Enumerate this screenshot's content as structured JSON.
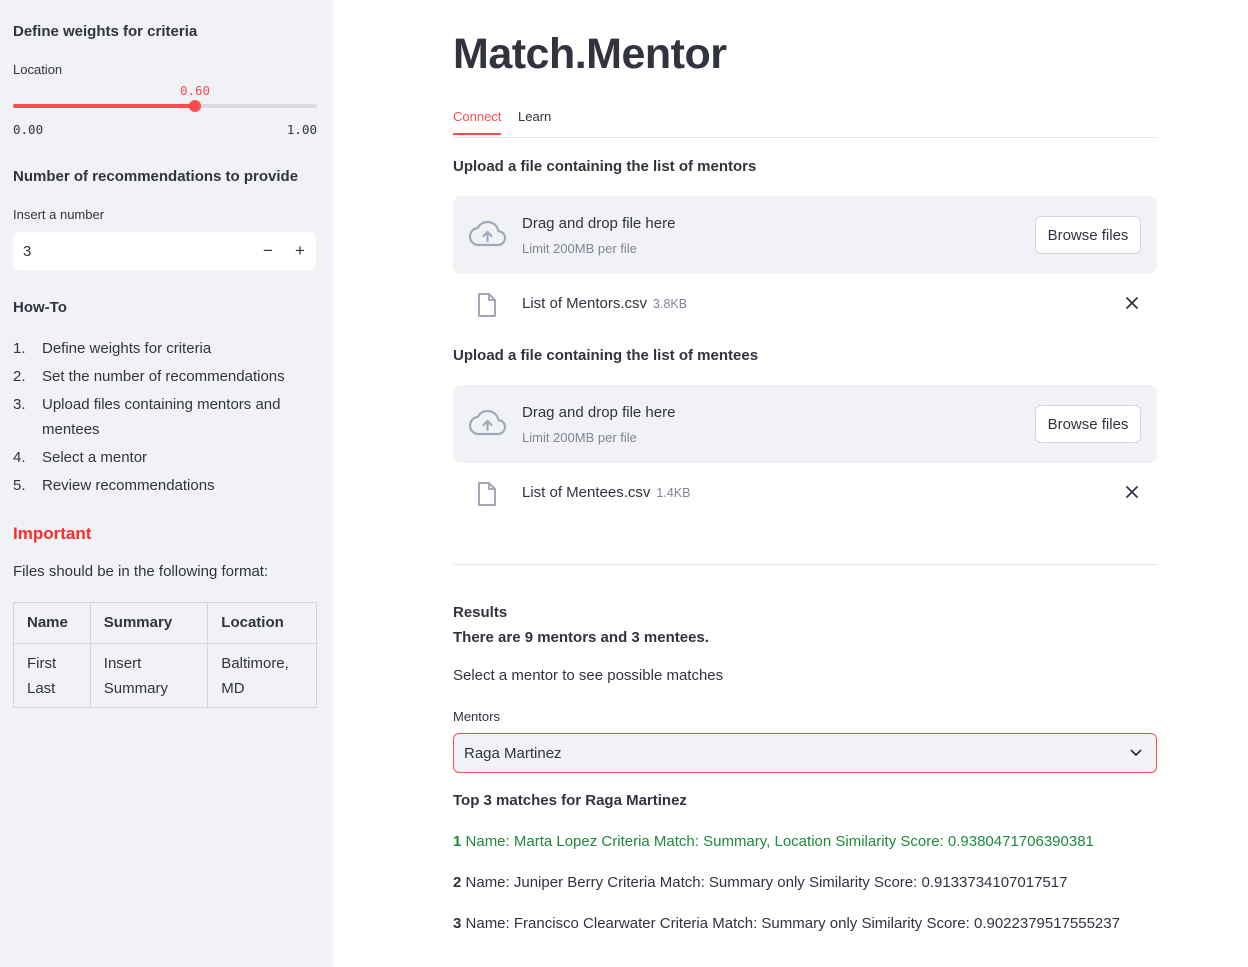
{
  "sidebar": {
    "weights_heading": "Define weights for criteria",
    "slider": {
      "label": "Location",
      "value_label": "0.60",
      "value": 0.6,
      "min_label": "0.00",
      "max_label": "1.00",
      "accent": "#ff4b4b"
    },
    "recs_heading": "Number of recommendations to provide",
    "number_input": {
      "label": "Insert a number",
      "value": "3",
      "minus": "−",
      "plus": "+"
    },
    "howto_heading": "How-To",
    "howto_steps": [
      {
        "n": "1.",
        "text": "Define weights for criteria"
      },
      {
        "n": "2.",
        "text": "Set the number of recommendations"
      },
      {
        "n": "3.",
        "text": "Upload files containing mentors and mentees"
      },
      {
        "n": "4.",
        "text": "Select a mentor"
      },
      {
        "n": "5.",
        "text": "Review recommendations"
      }
    ],
    "important_heading": "Important",
    "format_text": "Files should be in the following format:",
    "format_table": {
      "headers": [
        "Name",
        "Summary",
        "Location"
      ],
      "row": [
        "First Last",
        "Insert Summary",
        "Baltimore, MD"
      ]
    }
  },
  "main": {
    "title": "Match.Mentor",
    "tabs": [
      {
        "label": "Connect",
        "active": true
      },
      {
        "label": "Learn",
        "active": false
      }
    ],
    "uploads": [
      {
        "heading": "Upload a file containing the list of mentors",
        "drop_text": "Drag and drop file here",
        "limit_text": "Limit 200MB per file",
        "browse_label": "Browse files",
        "file_name": "List of Mentors.csv",
        "file_size": "3.8KB"
      },
      {
        "heading": "Upload a file containing the list of mentees",
        "drop_text": "Drag and drop file here",
        "limit_text": "Limit 200MB per file",
        "browse_label": "Browse files",
        "file_name": "List of Mentees.csv",
        "file_size": "1.4KB"
      }
    ],
    "results": {
      "heading": "Results",
      "summary": "There are 9 mentors and 3 mentees.",
      "instruction": "Select a mentor to see possible matches",
      "select_label": "Mentors",
      "selected_mentor": "Raga Martinez",
      "top_heading": "Top 3 matches for Raga Martinez",
      "matches": [
        {
          "rank": "1",
          "text": "Name: Marta Lopez Criteria Match: Summary, Location Similarity Score: 0.9380471706390381"
        },
        {
          "rank": "2",
          "text": "Name: Juniper Berry Criteria Match: Summary only Similarity Score: 0.9133734107017517"
        },
        {
          "rank": "3",
          "text": "Name: Francisco Clearwater Criteria Match: Summary only Similarity Score: 0.9022379517555237"
        }
      ]
    }
  },
  "colors": {
    "accent": "#ff4b4b",
    "sidebar_bg": "#f0f2f6",
    "top_match": "#1e8a3a"
  }
}
